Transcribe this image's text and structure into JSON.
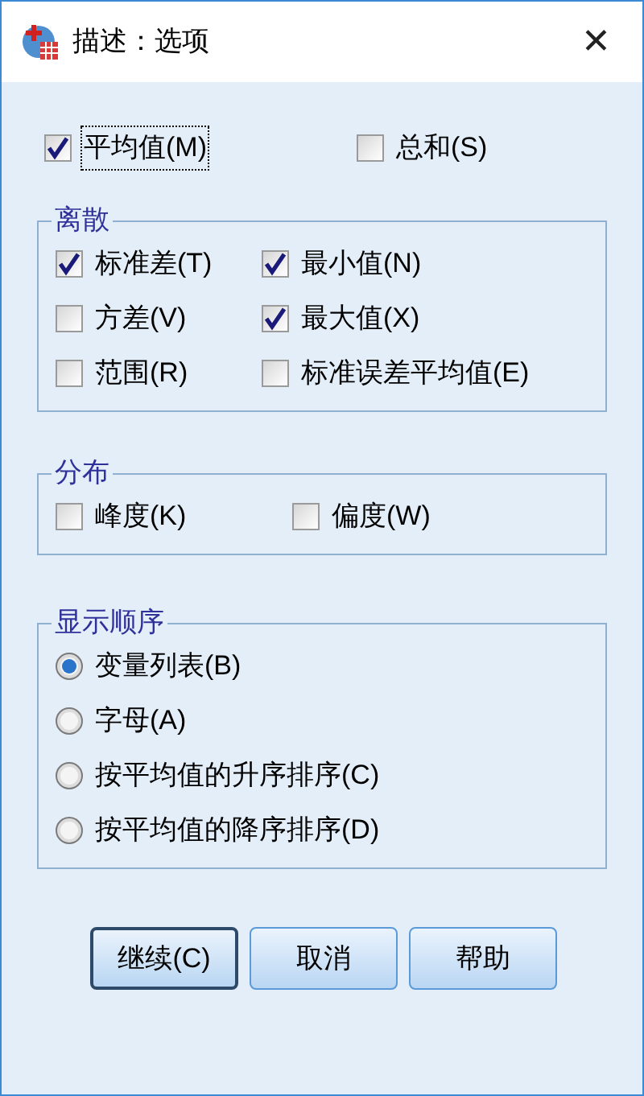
{
  "window": {
    "title": "描述：选项",
    "close": "✕"
  },
  "top_options": [
    {
      "label": "平均值(M)",
      "checked": true,
      "focused": true
    },
    {
      "label": "总和(S)",
      "checked": false,
      "focused": false
    }
  ],
  "groups": [
    {
      "title": "离散",
      "kind": "checkboxes",
      "items": [
        {
          "label": "标准差(T)",
          "checked": true
        },
        {
          "label": "最小值(N)",
          "checked": true
        },
        {
          "label": "方差(V)",
          "checked": false
        },
        {
          "label": "最大值(X)",
          "checked": true
        },
        {
          "label": "范围(R)",
          "checked": false
        },
        {
          "label": "标准误差平均值(E)",
          "checked": false
        }
      ]
    },
    {
      "title": "分布",
      "kind": "checkboxes",
      "items": [
        {
          "label": "峰度(K)",
          "checked": false
        },
        {
          "label": "偏度(W)",
          "checked": false
        }
      ]
    },
    {
      "title": "显示顺序",
      "kind": "radios",
      "items": [
        {
          "label": "变量列表(B)",
          "selected": true
        },
        {
          "label": "字母(A)",
          "selected": false
        },
        {
          "label": "按平均值的升序排序(C)",
          "selected": false
        },
        {
          "label": "按平均值的降序排序(D)",
          "selected": false
        }
      ]
    }
  ],
  "buttons": [
    {
      "label": "继续(C)",
      "default": true
    },
    {
      "label": "取消",
      "default": false
    },
    {
      "label": "帮助",
      "default": false
    }
  ]
}
